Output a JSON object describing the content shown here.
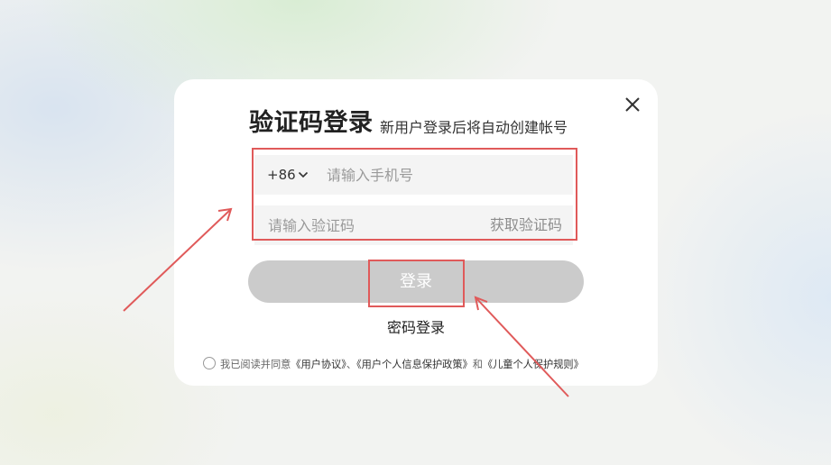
{
  "dialog": {
    "title": "验证码登录",
    "subtitle": "新用户登录后将自动创建帐号",
    "close_icon": "close-icon"
  },
  "phone": {
    "country_code": "+86",
    "placeholder": "请输入手机号",
    "value": ""
  },
  "code": {
    "placeholder": "请输入验证码",
    "value": "",
    "get_code_label": "获取验证码"
  },
  "login_button": "登录",
  "password_login_link": "密码登录",
  "agreement": {
    "prefix": "我已阅读并同意",
    "user_agreement": "《用户协议》",
    "sep1": "、",
    "privacy_policy": "《用户个人信息保护政策》",
    "conj": "和",
    "child_rules": "《儿童个人保护规则》"
  },
  "annotation_color": "#e05a5a"
}
